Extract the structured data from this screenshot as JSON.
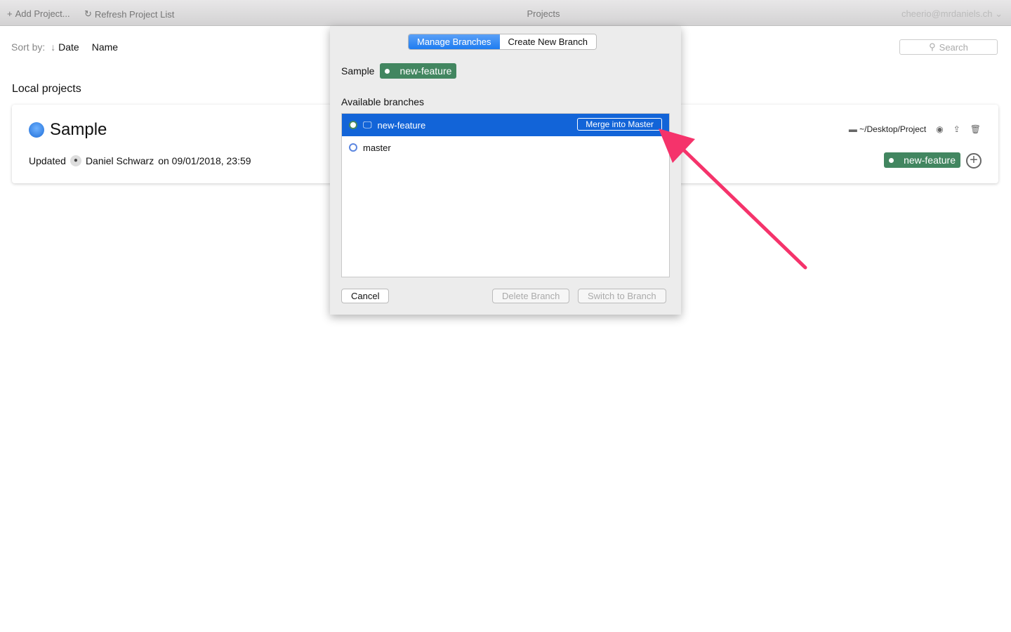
{
  "toolbar": {
    "add_project": "Add Project...",
    "refresh": "Refresh Project List",
    "title": "Projects",
    "user": "cheerio@mrdaniels.ch"
  },
  "sort": {
    "label": "Sort by:",
    "date": "Date",
    "name": "Name"
  },
  "search": {
    "placeholder": "Search"
  },
  "section_title": "Local projects",
  "project": {
    "name": "Sample",
    "updated_label": "Updated",
    "author": "Daniel Schwarz",
    "date": "on 09/01/2018, 23:59",
    "path": "~/Desktop/Project",
    "branch": "new-feature"
  },
  "dialog": {
    "tabs": [
      {
        "label": "Manage Branches",
        "active": true
      },
      {
        "label": "Create New Branch",
        "active": false
      }
    ],
    "project": "Sample",
    "current_branch": "new-feature",
    "available_label": "Available branches",
    "branches": [
      {
        "name": "new-feature",
        "selected": true,
        "action": "Merge into Master"
      },
      {
        "name": "master",
        "selected": false
      }
    ],
    "cancel": "Cancel",
    "delete": "Delete Branch",
    "switch": "Switch to Branch"
  },
  "colors": {
    "accent": "#1264d8",
    "branch_badge": "#428660",
    "annotation_arrow": "#f5336b"
  }
}
